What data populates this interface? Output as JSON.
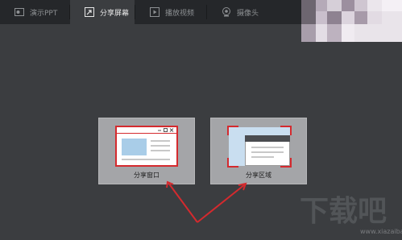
{
  "tabs": [
    {
      "label": "演示PPT",
      "icon": "ppt-icon",
      "active": false
    },
    {
      "label": "分享屏幕",
      "icon": "share-screen-icon",
      "active": true
    },
    {
      "label": "播放视频",
      "icon": "play-video-icon",
      "active": false
    },
    {
      "label": "摄像头",
      "icon": "camera-icon",
      "active": false
    }
  ],
  "options": {
    "share_window": "分享窗口",
    "share_region": "分享区域"
  },
  "watermark": {
    "text": "下载吧",
    "url": "www.xiazaiba.com"
  },
  "colors": {
    "accent": "#d42a2e",
    "tab_bar": "#25272a",
    "panel": "#3b3d40",
    "card": "#a4a5a8"
  }
}
